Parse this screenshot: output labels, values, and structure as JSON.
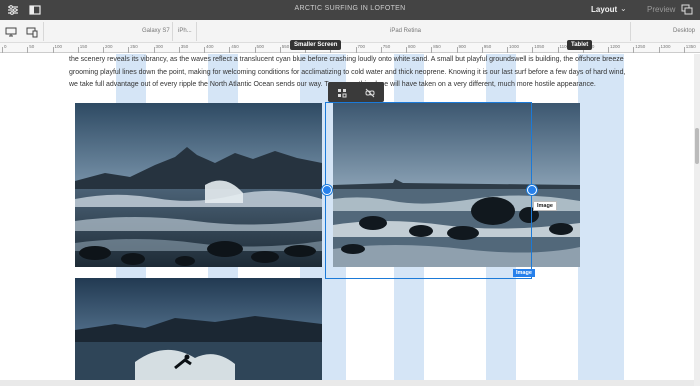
{
  "topbar": {
    "title": "ARCTIC SURFING IN LOFOTEN",
    "layout_label": "Layout",
    "layout_chevron": "⌄",
    "preview_label": "Preview",
    "left_icons": [
      "sliders-icon",
      "side-panel-icon"
    ],
    "right_icon": "annotations-icon"
  },
  "devices": {
    "icons": [
      "desktop-icon",
      "emulator-icon"
    ],
    "labels": [
      "Galaxy S7",
      "iPh...",
      "iPad Retina",
      "Desktop"
    ]
  },
  "ruler": {
    "ticks": [
      "0",
      "50",
      "100",
      "150",
      "200",
      "250",
      "300",
      "350",
      "400",
      "450",
      "500",
      "550",
      "600",
      "650",
      "700",
      "750",
      "800",
      "850",
      "900",
      "950",
      "1000",
      "1050",
      "1100",
      "1150",
      "1200",
      "1250",
      "1300",
      "1350"
    ]
  },
  "breakpoints": {
    "smaller_screen": "Smaller Screen",
    "tablet": "Tablet"
  },
  "content": {
    "paragraph": "the scenery reveals its vibrancy, as the waves reflect a translucent cyan blue before crashing loudly onto white sand. A small but playful groundswell is building, the offshore breeze grooming playful lines down the point, making for welcoming conditions for acclimatizing to cold water and thick neoprene. Knowing it is our last surf before a few days of hard wind, we take full advantage out of every ripple the North Atlantic Ocean sends our way. Tomorrow, this place will have taken on a very different, much more hostile appearance."
  },
  "selection": {
    "tag": "Image",
    "tooltip": "Image",
    "toolbar_icons": [
      "layout-grid-icon",
      "unlink-icon"
    ]
  },
  "images": [
    {
      "name": "surf-mountains-photo"
    },
    {
      "name": "surf-rocks-photo"
    },
    {
      "name": "surfer-wave-photo"
    }
  ]
}
